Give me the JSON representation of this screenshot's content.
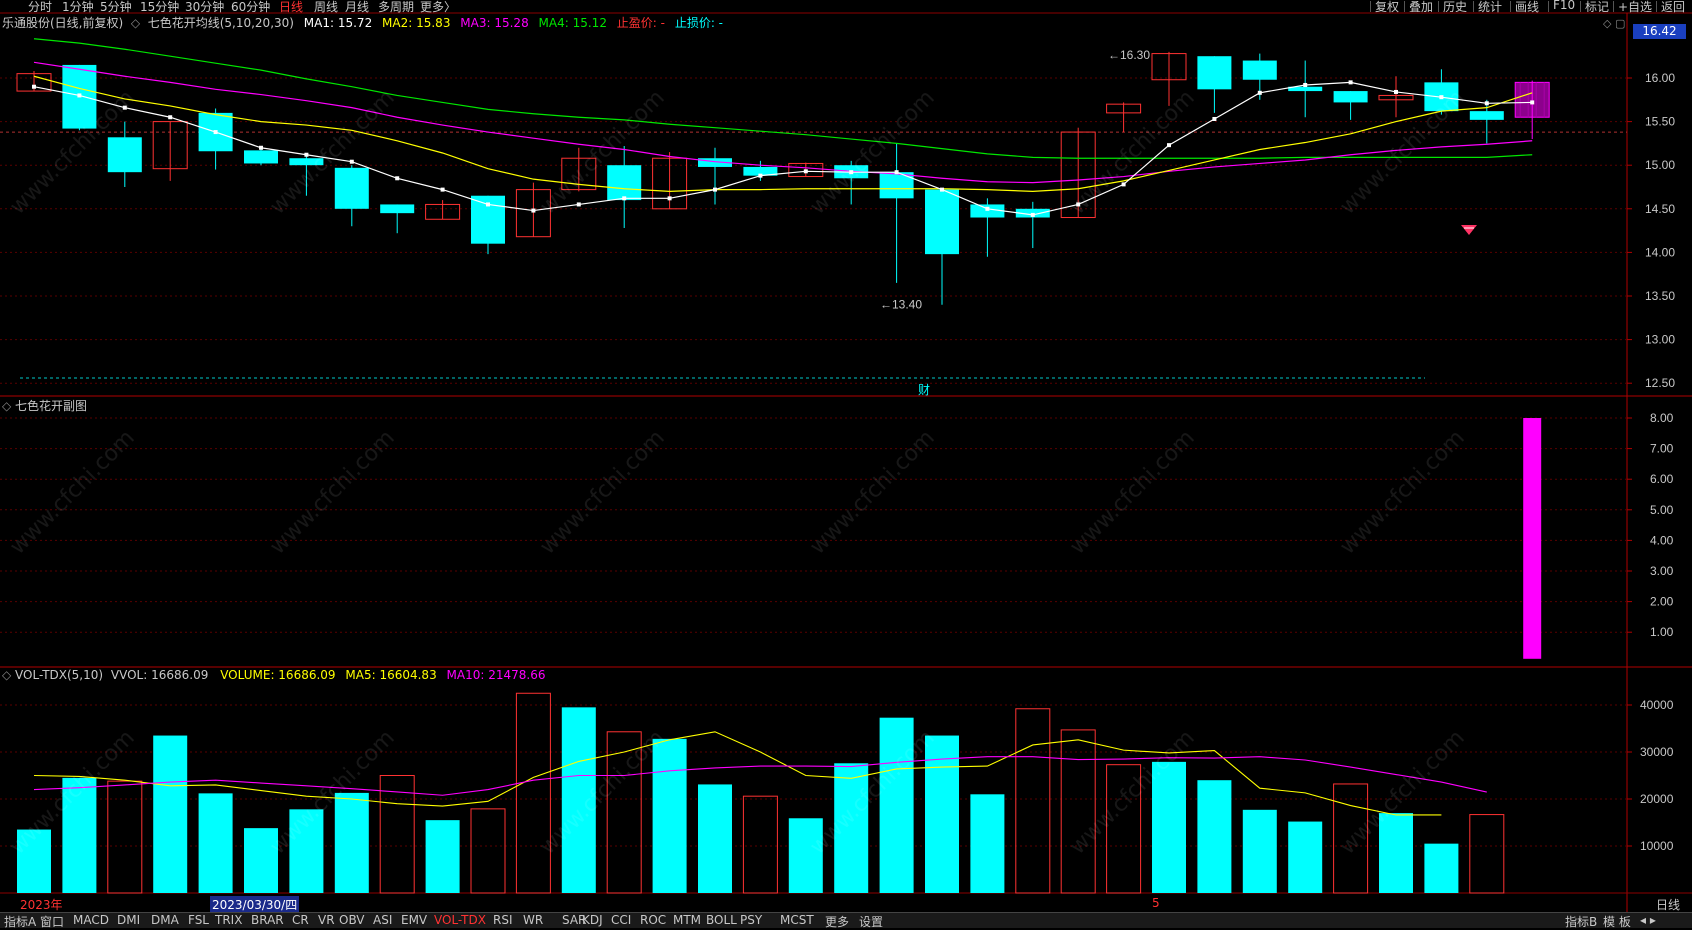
{
  "topbar": {
    "periods": [
      "分时",
      "1分钟",
      "5分钟",
      "15分钟",
      "30分钟",
      "60分钟",
      "日线",
      "周线",
      "月线",
      "多周期",
      "更多〉"
    ],
    "active_period": "日线",
    "right_buttons": [
      "复权",
      "叠加",
      "历史",
      "统计",
      "画线",
      "F10",
      "标记",
      "+自选",
      "返回"
    ]
  },
  "main_panel": {
    "stock": "乐通股份(日线,前复权)",
    "indicator": "七色花开均线(5,10,20,30)",
    "ma1": "MA1: 15.72",
    "ma2": "MA2: 15.83",
    "ma3": "MA3: 15.28",
    "ma4": "MA4: 15.12",
    "stop_profit": "止盈价: -",
    "stop_loss": "止损价: -",
    "last_price": "16.42",
    "high_label": "16.30",
    "low_label": "13.40",
    "cai_label": "财"
  },
  "sub_panel": {
    "title": "七色花开副图"
  },
  "vol_panel": {
    "name": "VOL-TDX(5,10)",
    "vvol": "VVOL: 16686.09",
    "volume": "VOLUME: 16686.09",
    "ma5": "MA5: 16604.83",
    "ma10": "MA10: 21478.66"
  },
  "date_labels": {
    "year": "2023年",
    "cursor_date": "2023/03/30/四",
    "month": "5"
  },
  "bottombar": {
    "tabs": [
      "指标A",
      "窗口",
      "MACD",
      "DMI",
      "DMA",
      "FSL",
      "TRIX",
      "BRAR",
      "CR",
      "VR",
      "OBV",
      "ASI",
      "EMV",
      "VOL-TDX",
      "RSI",
      "WR",
      "SAR",
      "KDJ",
      "CCI",
      "ROC",
      "MTM",
      "BOLL",
      "PSY",
      "MCST",
      "更多",
      "设置"
    ],
    "active_tab": "VOL-TDX",
    "right": [
      "指标B",
      "模 板"
    ],
    "period_label": "日线"
  },
  "colors": {
    "up": "#ff3232",
    "down": "#00ffff",
    "ma1": "#ffffff",
    "ma2": "#ffff00",
    "ma3": "#ff00ff",
    "ma4": "#00e600",
    "bg": "#000000"
  },
  "chart_data": {
    "type": "candlestick",
    "price_axis": {
      "ticks": [
        16.0,
        15.5,
        15.0,
        14.5,
        14.0,
        13.5,
        13.0,
        12.5
      ]
    },
    "sub_axis": {
      "ticks": [
        8.0,
        7.0,
        6.0,
        5.0,
        4.0,
        3.0,
        2.0,
        1.0
      ]
    },
    "volume_axis": {
      "ticks": [
        40000,
        30000,
        20000,
        10000
      ]
    },
    "candles": [
      {
        "o": 15.85,
        "h": 16.08,
        "l": 15.85,
        "c": 16.05
      },
      {
        "o": 16.15,
        "h": 16.15,
        "l": 15.4,
        "c": 15.42
      },
      {
        "o": 15.32,
        "h": 15.5,
        "l": 14.75,
        "c": 14.92
      },
      {
        "o": 14.96,
        "h": 15.5,
        "l": 14.82,
        "c": 15.5
      },
      {
        "o": 15.6,
        "h": 15.65,
        "l": 14.95,
        "c": 15.16
      },
      {
        "o": 15.17,
        "h": 15.22,
        "l": 15.0,
        "c": 15.02
      },
      {
        "o": 15.08,
        "h": 15.1,
        "l": 14.65,
        "c": 15.0
      },
      {
        "o": 14.97,
        "h": 15.0,
        "l": 14.3,
        "c": 14.5
      },
      {
        "o": 14.55,
        "h": 14.55,
        "l": 14.22,
        "c": 14.45
      },
      {
        "o": 14.38,
        "h": 14.6,
        "l": 14.38,
        "c": 14.55
      },
      {
        "o": 14.65,
        "h": 14.65,
        "l": 13.98,
        "c": 14.1
      },
      {
        "o": 14.18,
        "h": 14.8,
        "l": 14.18,
        "c": 14.72
      },
      {
        "o": 14.72,
        "h": 15.2,
        "l": 14.7,
        "c": 15.08
      },
      {
        "o": 15.0,
        "h": 15.22,
        "l": 14.28,
        "c": 14.6
      },
      {
        "o": 14.5,
        "h": 15.15,
        "l": 14.5,
        "c": 15.08
      },
      {
        "o": 15.08,
        "h": 15.2,
        "l": 14.55,
        "c": 14.98
      },
      {
        "o": 14.98,
        "h": 15.05,
        "l": 14.82,
        "c": 14.88
      },
      {
        "o": 14.87,
        "h": 15.03,
        "l": 14.87,
        "c": 15.02
      },
      {
        "o": 15.0,
        "h": 15.05,
        "l": 14.55,
        "c": 14.85
      },
      {
        "o": 14.92,
        "h": 15.25,
        "l": 13.65,
        "c": 14.62
      },
      {
        "o": 14.72,
        "h": 14.72,
        "l": 13.4,
        "c": 13.98
      },
      {
        "o": 14.55,
        "h": 14.62,
        "l": 13.95,
        "c": 14.4
      },
      {
        "o": 14.5,
        "h": 14.58,
        "l": 14.05,
        "c": 14.4
      },
      {
        "o": 14.4,
        "h": 15.43,
        "l": 14.4,
        "c": 15.38
      },
      {
        "o": 15.6,
        "h": 15.72,
        "l": 15.38,
        "c": 15.7
      },
      {
        "o": 15.98,
        "h": 16.3,
        "l": 15.68,
        "c": 16.28
      },
      {
        "o": 16.25,
        "h": 16.25,
        "l": 15.6,
        "c": 15.87
      },
      {
        "o": 16.2,
        "h": 16.28,
        "l": 15.75,
        "c": 15.98
      },
      {
        "o": 15.9,
        "h": 16.2,
        "l": 15.55,
        "c": 15.85
      },
      {
        "o": 15.85,
        "h": 15.85,
        "l": 15.52,
        "c": 15.72
      },
      {
        "o": 15.75,
        "h": 16.02,
        "l": 15.55,
        "c": 15.8
      },
      {
        "o": 15.95,
        "h": 16.1,
        "l": 15.58,
        "c": 15.62
      },
      {
        "o": 15.62,
        "h": 15.75,
        "l": 15.25,
        "c": 15.52
      },
      {
        "o": 15.55,
        "h": 15.97,
        "l": 15.3,
        "c": 15.95
      }
    ],
    "ma1": [
      15.9,
      15.8,
      15.66,
      15.55,
      15.38,
      15.2,
      15.12,
      15.04,
      14.85,
      14.72,
      14.55,
      14.48,
      14.55,
      14.62,
      14.62,
      14.72,
      14.88,
      14.93,
      14.92,
      14.92,
      14.72,
      14.5,
      14.43,
      14.55,
      14.78,
      15.23,
      15.53,
      15.83,
      15.92,
      15.95,
      15.84,
      15.78,
      15.71,
      15.72
    ],
    "ma2": [
      16.02,
      15.88,
      15.76,
      15.68,
      15.58,
      15.5,
      15.46,
      15.4,
      15.28,
      15.14,
      14.96,
      14.84,
      14.78,
      14.73,
      14.7,
      14.72,
      14.72,
      14.73,
      14.73,
      14.73,
      14.73,
      14.72,
      14.7,
      14.73,
      14.82,
      14.94,
      15.06,
      15.18,
      15.26,
      15.36,
      15.5,
      15.62,
      15.66,
      15.83
    ],
    "ma3": [
      16.18,
      16.1,
      16.02,
      15.95,
      15.87,
      15.81,
      15.74,
      15.66,
      15.55,
      15.46,
      15.38,
      15.31,
      15.24,
      15.18,
      15.1,
      15.04,
      15.0,
      14.97,
      14.93,
      14.9,
      14.85,
      14.81,
      14.8,
      14.83,
      14.87,
      14.93,
      14.98,
      15.02,
      15.06,
      15.12,
      15.17,
      15.21,
      15.24,
      15.28
    ],
    "ma4": [
      16.45,
      16.4,
      16.33,
      16.25,
      16.17,
      16.09,
      15.99,
      15.9,
      15.8,
      15.72,
      15.64,
      15.59,
      15.55,
      15.52,
      15.47,
      15.43,
      15.39,
      15.35,
      15.3,
      15.25,
      15.19,
      15.13,
      15.09,
      15.08,
      15.08,
      15.08,
      15.08,
      15.08,
      15.09,
      15.09,
      15.09,
      15.09,
      15.09,
      15.12
    ],
    "volume": [
      13500,
      24500,
      23800,
      33500,
      21200,
      13800,
      17800,
      21300,
      25000,
      15500,
      17900,
      42500,
      39500,
      34300,
      32800,
      23100,
      20600,
      15900,
      27600,
      37300,
      33500,
      21000,
      39200,
      34700,
      27300,
      27900,
      24000,
      17700,
      15200,
      23200,
      17000,
      10500,
      16686
    ],
    "vol_ma5": [
      25000,
      24800,
      24000,
      22800,
      23000,
      21800,
      20600,
      20000,
      19000,
      18500,
      19500,
      24600,
      28000,
      30000,
      32600,
      34300,
      30000,
      25000,
      24400,
      26400,
      26800,
      27000,
      31500,
      32600,
      30400,
      29800,
      30300,
      22300,
      21300,
      18600,
      16600,
      16604
    ],
    "vol_ma10": [
      22000,
      22400,
      23000,
      23600,
      24000,
      23400,
      22800,
      22200,
      21500,
      20800,
      22000,
      24000,
      25000,
      25000,
      26000,
      26600,
      27000,
      27000,
      26900,
      27800,
      28500,
      29000,
      29000,
      28400,
      28500,
      28800,
      28700,
      29000,
      28300,
      26800,
      25200,
      23600,
      21478
    ],
    "sub_bar_value": 8.0
  }
}
